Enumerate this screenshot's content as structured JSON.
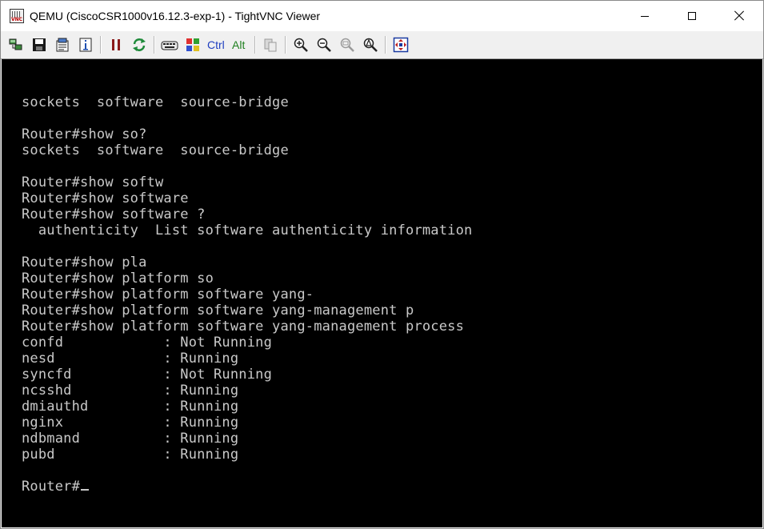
{
  "window": {
    "title": "QEMU (CiscoCSR1000v16.12.3-exp-1) - TightVNC Viewer",
    "app_icon_text": "VNC"
  },
  "toolbar": {
    "ctrl_label": "Ctrl",
    "alt_label": "Alt",
    "buttons": [
      {
        "name": "new-connection",
        "icon": "new-connection-icon"
      },
      {
        "name": "save-session",
        "icon": "floppy-disk-icon"
      },
      {
        "name": "options",
        "icon": "options-icon"
      },
      {
        "name": "connection-info",
        "icon": "info-icon"
      },
      {
        "name": "pause",
        "icon": "pause-icon"
      },
      {
        "name": "refresh",
        "icon": "refresh-icon"
      },
      {
        "name": "ctrl-alt-del",
        "icon": "ctrl-alt-del-icon"
      },
      {
        "name": "ctrl-esc",
        "icon": "windows-start-icon"
      },
      {
        "name": "ctrl-toggle",
        "icon": "ctrl-key-icon"
      },
      {
        "name": "alt-toggle",
        "icon": "alt-key-icon"
      },
      {
        "name": "transfer-clipboard",
        "icon": "clipboard-icon"
      },
      {
        "name": "zoom-in",
        "icon": "zoom-in-icon"
      },
      {
        "name": "zoom-out",
        "icon": "zoom-out-icon"
      },
      {
        "name": "zoom-100",
        "icon": "zoom-100-icon"
      },
      {
        "name": "zoom-auto",
        "icon": "zoom-auto-icon"
      },
      {
        "name": "full-screen",
        "icon": "full-screen-icon"
      }
    ]
  },
  "colors": {
    "terminal_bg": "#000000",
    "terminal_fg": "#c9c9c9",
    "toolbar_bg": "#f0f0f0"
  },
  "terminal": {
    "lines": [
      "sockets  software  source-bridge",
      "",
      "Router#show so?",
      "sockets  software  source-bridge",
      "",
      "Router#show softw",
      "Router#show software",
      "Router#show software ?",
      "  authenticity  List software authenticity information",
      "",
      "Router#show pla",
      "Router#show platform so",
      "Router#show platform software yang-",
      "Router#show platform software yang-management p",
      "Router#show platform software yang-management process",
      "confd            : Not Running",
      "nesd             : Running",
      "syncfd           : Not Running",
      "ncsshd           : Running",
      "dmiauthd         : Running",
      "nginx            : Running",
      "ndbmand          : Running",
      "pubd             : Running",
      ""
    ],
    "prompt": "Router#"
  }
}
